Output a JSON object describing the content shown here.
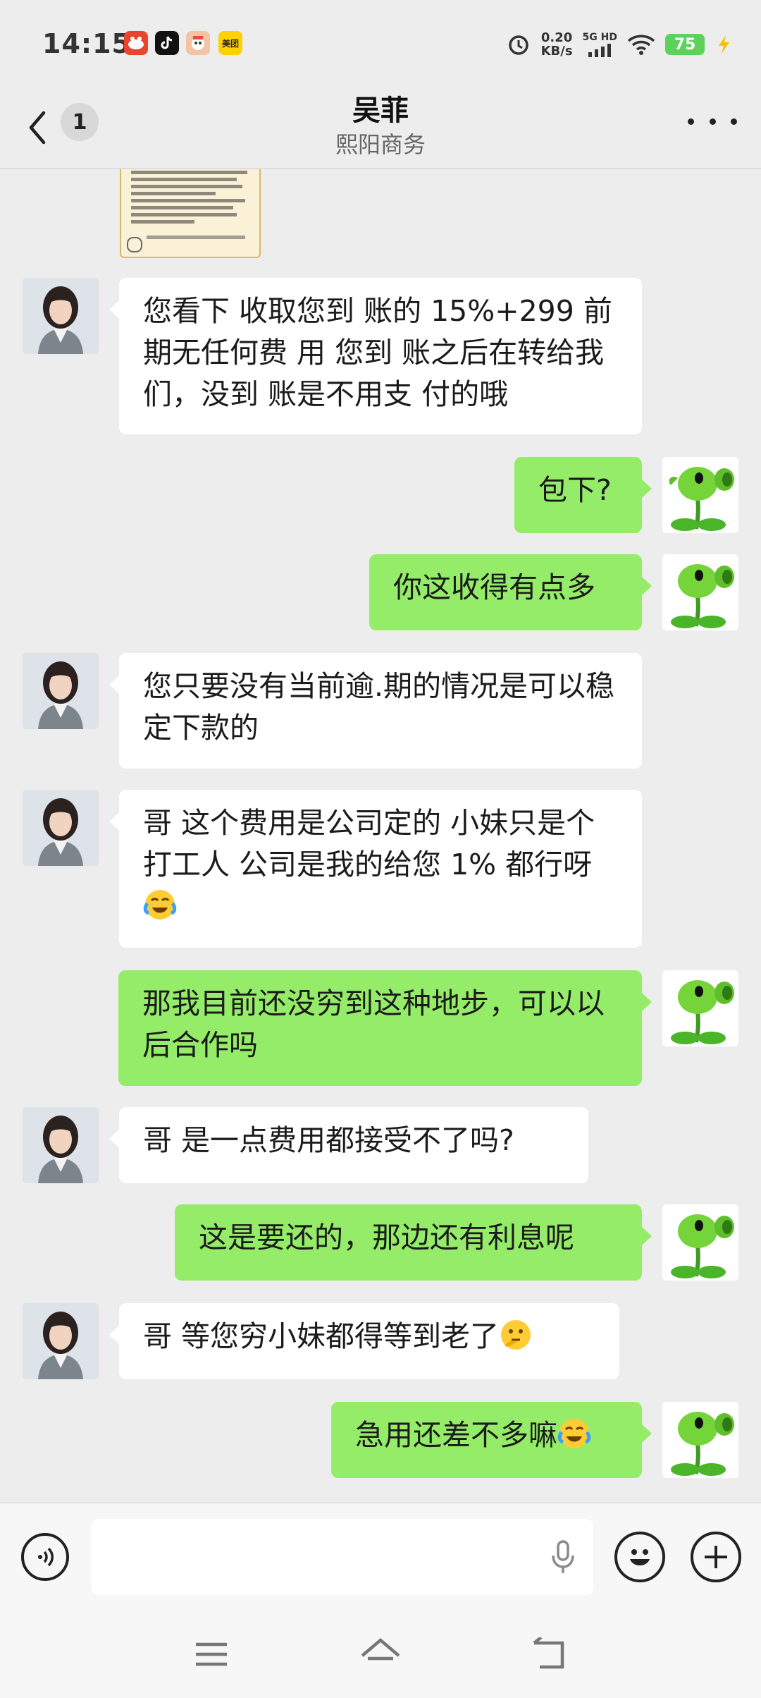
{
  "status_bar": {
    "time": "14:15",
    "meituan_label": "美团",
    "net_speed_value": "0.20",
    "net_speed_unit": "KB/s",
    "network_label": "5G HD",
    "battery": "75"
  },
  "header": {
    "unread_count": "1",
    "contact_name": "吴菲",
    "contact_subtitle": "熙阳商务"
  },
  "messages": [
    {
      "side": "in",
      "text": "您看下 收取您到 账的 15%+299 前期无任何费 用 您到 账之后在转给我们，没到 账是不用支 付的哦"
    },
    {
      "side": "out",
      "text": "包下?"
    },
    {
      "side": "out",
      "text": "你这收得有点多"
    },
    {
      "side": "in",
      "text": "您只要没有当前逾.期的情况是可以稳定下款的"
    },
    {
      "side": "in",
      "text": "哥   这个费用是公司定的  小妹只是个打工人  公司是我的给您 1% 都行呀"
    },
    {
      "side": "out",
      "text": "那我目前还没穷到这种地步，可以以后合作吗"
    },
    {
      "side": "in",
      "text": "哥  是一点费用都接受不了吗?"
    },
    {
      "side": "out",
      "text": "这是要还的，那边还有利息呢"
    },
    {
      "side": "in",
      "text": "哥   等您穷小妹都得等到老了"
    },
    {
      "side": "out",
      "text": "急用还差不多嘛"
    }
  ],
  "icons": {
    "back": "chevron-left-icon",
    "more": "more-dots-icon",
    "voice": "voice-mode-icon",
    "mic": "microphone-icon",
    "emoji": "emoji-icon",
    "plus": "plus-icon",
    "menu": "menu-icon",
    "home": "home-icon",
    "return": "back-icon"
  },
  "colors": {
    "outgoing_bubble": "#95ec69",
    "incoming_bubble": "#ffffff",
    "background": "#ededed"
  }
}
